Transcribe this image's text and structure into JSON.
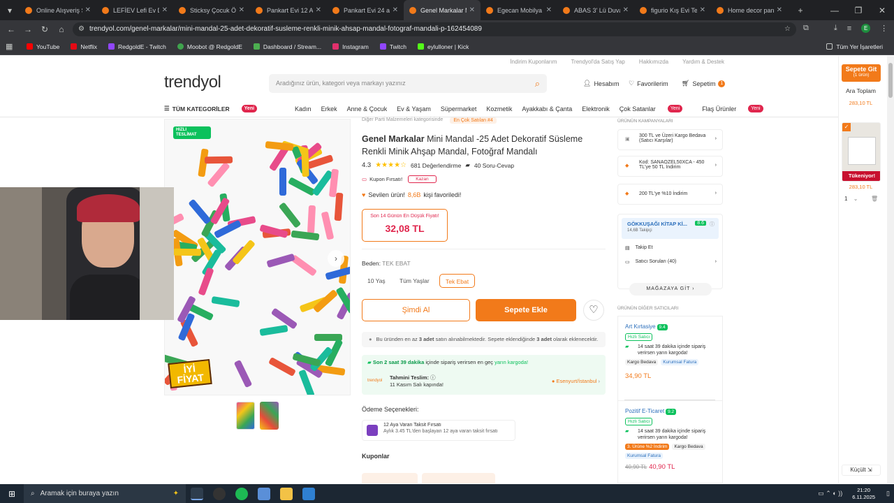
{
  "browser": {
    "tabs": [
      {
        "label": "Online Alışveriş Sit",
        "active": false
      },
      {
        "label": "LEFİEV Lefi Ev Deko",
        "active": false
      },
      {
        "label": "Sticksy Çocuk Öğr",
        "active": false
      },
      {
        "label": "Pankart Evi 12 Adet",
        "active": false
      },
      {
        "label": "Pankart Evi 24 adet",
        "active": false
      },
      {
        "label": "Genel Markalar M",
        "active": true
      },
      {
        "label": "Egecan Mobilya B",
        "active": false
      },
      {
        "label": "ABAS 3' Lü Duvar",
        "active": false
      },
      {
        "label": "figurio Kış Evi Tea",
        "active": false
      },
      {
        "label": "Home decor pano",
        "active": false
      }
    ],
    "url": "trendyol.com/genel-markalar/mini-mandal-25-adet-dekoratif-susleme-renkli-minik-ahsap-mandal-fotograf-mandali-p-162454089",
    "bookmarks": [
      "YouTube",
      "Netflix",
      "RedgoldE - Twitch",
      "Moobot @ RedgoldE",
      "Dashboard / Stream...",
      "Instagram",
      "Twitch",
      "eylulloner | Kick"
    ],
    "all_bookmarks": "Tüm Yer İşaretleri"
  },
  "site": {
    "top_links": [
      "İndirim Kuponlarım",
      "Trendyol'da Satış Yap",
      "Hakkımızda",
      "Yardım & Destek"
    ],
    "logo": "trendyol",
    "search_placeholder": "Aradığınız ürün, kategori veya markayı yazınız",
    "account": "Hesabım",
    "favorites": "Favorilerim",
    "cart": "Sepetim",
    "cart_count": "1",
    "all_categories": "TÜM KATEGORİLER",
    "yeni": "Yeni",
    "categories": [
      "Kadın",
      "Erkek",
      "Anne & Çocuk",
      "Ev & Yaşam",
      "Süpermarket",
      "Kozmetik",
      "Ayakkabı & Çanta",
      "Elektronik"
    ],
    "bestsellers": "Çok Satanlar",
    "flash": "Flaş Ürünler"
  },
  "product": {
    "breadcrumb_note": "Diğer Parti Malzemeleri kategorisinde",
    "bestseller_badge": "En Çok Satılan #4",
    "brand": "Genel Markalar",
    "title": "Mini Mandal -25 Adet Dekoratif Süsleme Renkli Minik Ahşap Mandal, Fotoğraf Mandalı",
    "rating": "4.3",
    "reviews": "681 Değerlendirme",
    "qa": "40 Soru-Cevap",
    "coupon": "Kupon Fırsatı!",
    "coupon_btn": "Kazan",
    "fav_text": "Sevilen ürün!",
    "fav_count": "8,6B",
    "fav_suffix": "kişi favoriledi!",
    "lowest_label": "Son 14 Günün En Düşük Fiyatı!",
    "price": "32,08 TL",
    "size_label": "Beden:",
    "size_value": "TEK EBAT",
    "sizes": [
      "10 Yaş",
      "Tüm Yaşlar",
      "Tek Ebat"
    ],
    "buy_now": "Şimdi Al",
    "add_to_cart": "Sepete Ekle",
    "limit_info_1": "Bu üründen en az ",
    "limit_info_b1": "3 adet",
    "limit_info_2": " satın alınabilmektedir. Sepete eklendiğinde ",
    "limit_info_b2": "3 adet",
    "limit_info_3": " olarak eklenecektir.",
    "shipping_prefix": "Son 2 saat 39 dakika",
    "shipping_mid": " içinde sipariş verirsen en geç ",
    "shipping_link": "yarın kargoda!",
    "delivery_label": "Tahmini Teslim:",
    "delivery_date": "11 Kasım Salı kapında!",
    "location": "Esenyurt/İstanbul",
    "payment_title": "Ödeme Seçenekleri:",
    "installment_title": "12 Aya Varan Taksit Fırsatı",
    "installment_sub": "Aylık 3.45 TL'den başlayan 12 aya varan taksit fırsatı",
    "coupons_title": "Kuponlar",
    "hizli": "HIZLI TESLİMAT",
    "iyi_fiyat": "İYİ FİYAT"
  },
  "campaigns": {
    "title": "ÜRÜNÜN KAMPANYALARI",
    "items": [
      "300 TL ve Üzeri Kargo Bedava (Satıcı Karşılar)",
      "Kod: SANAOZEL50XCA - 450 TL'ye 50 TL İndirim",
      "200 TL'ye %10 İndirim"
    ]
  },
  "store": {
    "name": "GÖKKUŞAĞI KİTAP Kİ...",
    "score": "8.6",
    "followers": "14,6B Takipçi",
    "follow": "Takip Et",
    "questions": "Satıcı Soruları (40)",
    "go": "MAĞAZAYA GİT"
  },
  "other_sellers": {
    "title": "ÜRÜNÜN DİĞER SATICILARI",
    "sellers": [
      {
        "name": "Art Kırtasiye",
        "score": "9.4",
        "fast": "Hızlı Satıcı",
        "ship": "14 saat 39 dakika içinde sipariş verirsen yarın kargoda!",
        "tags": [
          "Kargo Bedava",
          "Kurumsal Fatura"
        ],
        "price": "34,90 TL"
      },
      {
        "name": "Pozitif E-Ticaret",
        "score": "9.2",
        "fast": "Hızlı Satıcı",
        "ship": "14 saat 39 dakika içinde sipariş verirsen yarın kargoda!",
        "tags": [
          "3. Ürüne %2 İndirim",
          "Kargo Bedava",
          "Kurumsal Fatura"
        ],
        "price_old": "40,90 TL",
        "price": "40,90 TL"
      }
    ]
  },
  "cart_panel": {
    "go": "Sepete Git",
    "count": "(1 ürün)",
    "subtotal_label": "Ara Toplam",
    "subtotal": "283,10 TL",
    "badge": "Tükeniyor!",
    "item_price": "283,10 TL",
    "qty": "1",
    "shrink": "Küçült"
  },
  "taskbar": {
    "search": "Aramak için buraya yazın",
    "time": "21:20",
    "date": "6.11.2025"
  },
  "colors": {
    "accent": "#f27a1a",
    "chrome_dark": "#202124",
    "green": "#0bc15c"
  }
}
